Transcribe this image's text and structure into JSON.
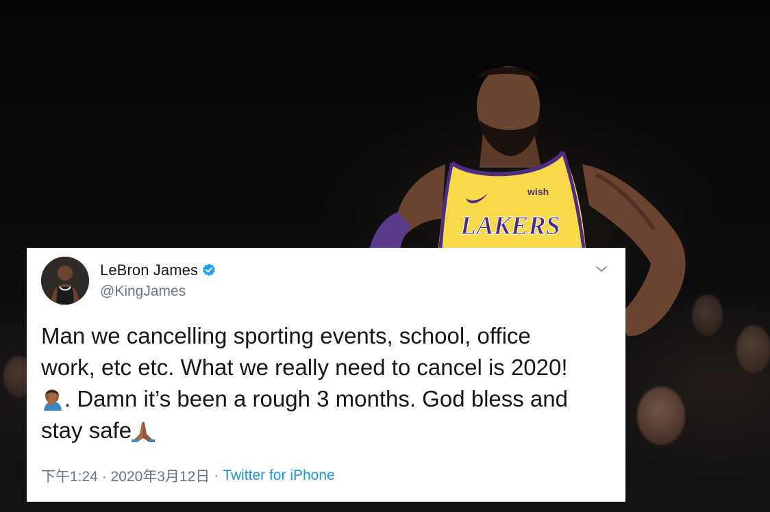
{
  "tweet": {
    "author_name": "LeBron James",
    "author_handle": "@KingJames",
    "verified": true,
    "text_line1": "Man we cancelling sporting events, school, office",
    "text_line2": "work, etc etc. What we really need to cancel is 2020!",
    "text_line3": ". Damn it’s been a rough 3 months. God bless and",
    "text_line4": "stay safe",
    "time": "下午1:24 · 2020年3月12日",
    "separator": "·",
    "source": "Twitter for iPhone",
    "icons": [
      "verified-badge-icon",
      "chevron-down-icon",
      "facepalm-emoji-icon",
      "praying-hands-emoji-icon"
    ]
  },
  "jersey": {
    "team_text": "LAKERS",
    "sponsor_text": "wish"
  },
  "colors": {
    "verified": "#1da1f2",
    "link": "#1b95e0",
    "muted": "#657786",
    "jersey_gold": "#f7d94a",
    "jersey_purple": "#4f2c83"
  }
}
